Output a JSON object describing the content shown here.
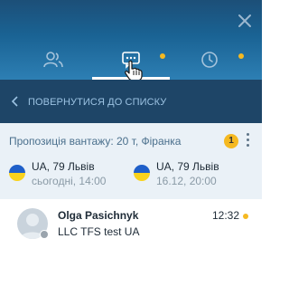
{
  "header": {
    "tabs": [
      {
        "name": "contacts",
        "icon": "users-icon",
        "unread": false
      },
      {
        "name": "requests",
        "icon": "chat-bubble-icon",
        "unread": true,
        "active": true
      },
      {
        "name": "history",
        "icon": "clock-icon",
        "unread": true
      }
    ],
    "close_icon": "close-icon"
  },
  "back_bar": {
    "label": "ПОВЕРНУТИСЯ ДО СПИСКУ",
    "icon": "chevron-left-icon"
  },
  "offer": {
    "title": "Пропозиція вантажу: 20 т, Фіранка",
    "badge_count": "1",
    "from": {
      "city": "UA, 79 Львів",
      "date": "сьогодні, 14:00"
    },
    "to": {
      "city": "UA, 79 Львів",
      "date": "16.12, 20:00"
    }
  },
  "message": {
    "sender": "Olga Pasichnyk",
    "time": "12:32",
    "preview": "LLC TFS test UA"
  },
  "colors": {
    "header_top": "#1c4f78",
    "back_bar": "#1e4567",
    "card_bg": "#eaf1f7",
    "accent_dot": "#f5b921",
    "flag_blue": "#1f5fc9",
    "flag_yellow": "#f9d21d"
  }
}
